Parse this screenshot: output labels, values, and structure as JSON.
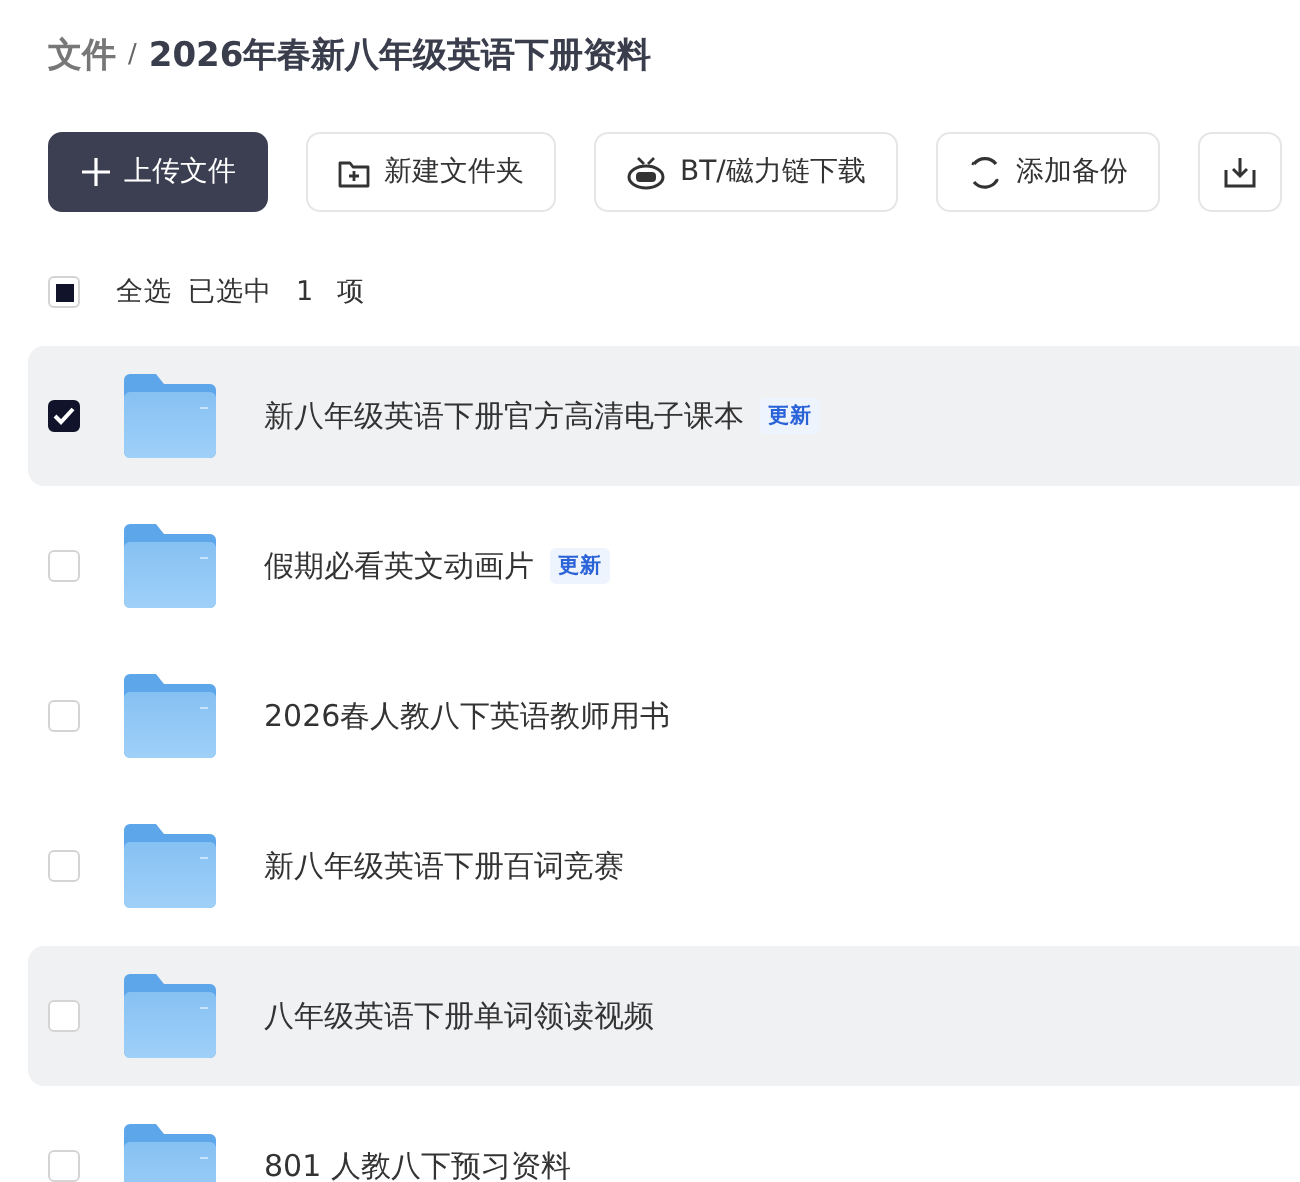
{
  "breadcrumb": {
    "root": "文件",
    "separator": "/",
    "current": "2026年春新八年级英语下册资料"
  },
  "toolbar": [
    {
      "kind": "primary",
      "label": "上传文件"
    },
    {
      "kind": "new-folder",
      "label": "新建文件夹"
    },
    {
      "kind": "bt",
      "label": "BT/磁力链下载"
    },
    {
      "kind": "backup",
      "label": "添加备份"
    },
    {
      "kind": "download"
    }
  ],
  "select_all": {
    "checked": true,
    "partial": true,
    "label": "全选",
    "summary": "已选中",
    "count": "1",
    "unit": "项"
  },
  "files": [
    {
      "name": "新八年级英语下册官方高清电子课本",
      "badge": "更新",
      "selected": true,
      "highlighted": true
    },
    {
      "name": "假期必看英文动画片",
      "badge": "更新",
      "selected": false,
      "highlighted": false
    },
    {
      "name": "2026春人教八下英语教师用书",
      "selected": false,
      "highlighted": false
    },
    {
      "name": "新八年级英语下册百词竞赛",
      "selected": false,
      "highlighted": false
    },
    {
      "name": "八年级英语下册单词领读视频",
      "selected": false,
      "highlighted": true
    },
    {
      "name": "801 人教八下预习资料",
      "selected": false,
      "highlighted": false
    }
  ]
}
